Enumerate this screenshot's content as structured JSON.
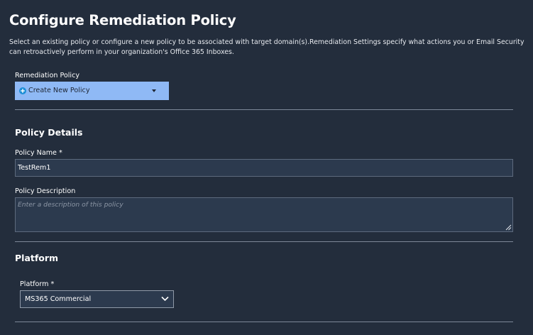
{
  "header": {
    "title": "Configure Remediation Policy",
    "description": "Select an existing policy or configure a new policy to be associated with target domain(s).Remediation Settings specify what actions you or Email Security can retroactively perform in your organization's Office 365 Inboxes."
  },
  "remediation_policy": {
    "label": "Remediation Policy",
    "selected": "Create New Policy",
    "icon": "plus-circle-icon",
    "background_color": "#8fb9f5",
    "icon_color": "#1f8fd6"
  },
  "policy_details": {
    "section_title": "Policy Details",
    "name_label": "Policy Name *",
    "name_value": "TestRem1",
    "description_label": "Policy Description",
    "description_placeholder": "Enter a description of this policy",
    "description_value": ""
  },
  "platform": {
    "section_title": "Platform",
    "label": "Platform *",
    "selected": "MS365 Commercial",
    "icon": "chevron-down-icon"
  },
  "colors": {
    "background": "#232d3c",
    "input_background": "#2c3a4e",
    "divider": "#7d8898"
  }
}
